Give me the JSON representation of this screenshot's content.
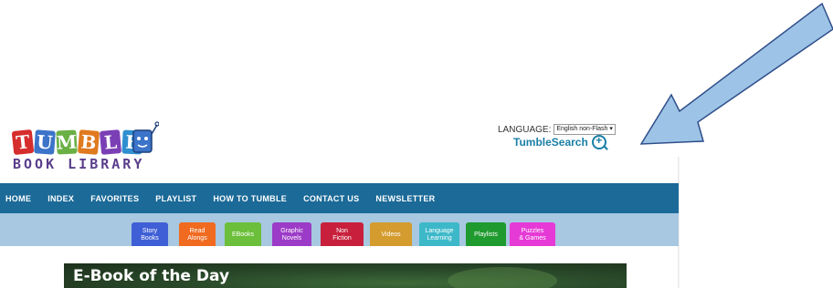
{
  "logo": {
    "letters": [
      "T",
      "U",
      "M",
      "B",
      "L",
      "E"
    ],
    "letter_colors": [
      "#d62d2d",
      "#3b74c9",
      "#6ab045",
      "#e07a1f",
      "#7b3fb5",
      "#2f8fd0"
    ],
    "subtitle": "BOOK LIBRARY"
  },
  "header": {
    "language_label": "LANGUAGE:",
    "language_selected": "English non-Flash",
    "tumblesearch_label": "TumbleSearch"
  },
  "nav": {
    "items": [
      "HOME",
      "INDEX",
      "FAVORITES",
      "PLAYLIST",
      "HOW TO TUMBLE",
      "CONTACT US",
      "NEWSLETTER"
    ]
  },
  "categories": [
    {
      "label": "Story\nBooks",
      "color": "#3f5fd6"
    },
    {
      "label": "Read\nAlongs",
      "color": "#f06a20"
    },
    {
      "label": "EBooks",
      "color": "#6cbf3a"
    },
    {
      "label": "Graphic\nNovels",
      "color": "#9b3bc7"
    },
    {
      "label": "Non\nFiction",
      "color": "#c8203c"
    },
    {
      "label": "Videos",
      "color": "#d49b2e"
    },
    {
      "label": "Language\nLearning",
      "color": "#3cb8c9"
    },
    {
      "label": "Playlists",
      "color": "#1f9a2f"
    },
    {
      "label": "Puzzles\n& Games",
      "color": "#e63ad6"
    }
  ],
  "hero": {
    "title": "E-Book of the Day"
  },
  "colors": {
    "navbar": "#1b6a98",
    "catbar": "#a7c8e0",
    "arrow_fill": "#9dc3e6",
    "arrow_stroke": "#2f4e8a"
  }
}
